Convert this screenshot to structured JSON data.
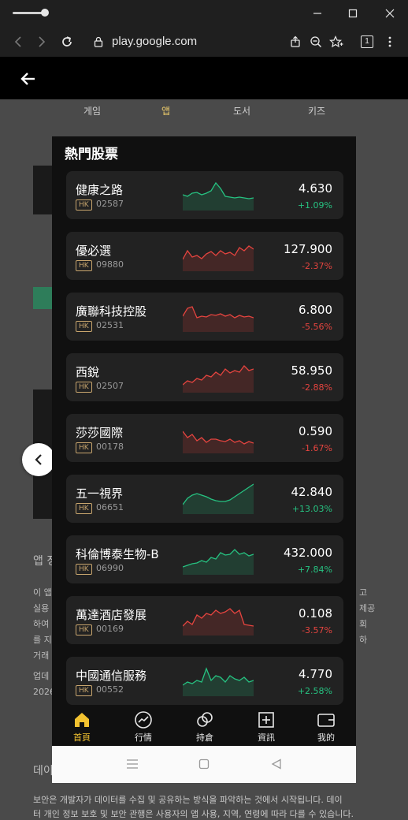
{
  "browser": {
    "url": "play.google.com",
    "tab_count": "1"
  },
  "store_tabs": [
    "게임",
    "앱",
    "도서",
    "키즈"
  ],
  "bg_snippets": {
    "l1": "이 앱",
    "l2": "실용",
    "l3": "하여",
    "l4": "를 지",
    "l5": "거래",
    "safety_title": "업데",
    "safety_year": "2026",
    "section_a": "앱 정",
    "section_b": "데이",
    "right1": "고",
    "right2": "제공",
    "right3": "회",
    "right4": "하",
    "footer1": "보안은 개발자가 데이터를 수집 및 공유하는 방식을 파악하는 것에서 시작됩니다. 데이",
    "footer2": "터 개인 정보 보호 및 보안 관행은 사용자의 앱 사용, 지역, 연령에 따라 다를 수 있습니다."
  },
  "app": {
    "title": "熱門股票",
    "stocks": [
      {
        "name": "健康之路",
        "market": "HK",
        "code": "02587",
        "price": "4.630",
        "change": "+1.09%",
        "dir": "up"
      },
      {
        "name": "優必選",
        "market": "HK",
        "code": "09880",
        "price": "127.900",
        "change": "-2.37%",
        "dir": "down"
      },
      {
        "name": "廣聯科技控股",
        "market": "HK",
        "code": "02531",
        "price": "6.800",
        "change": "-5.56%",
        "dir": "down"
      },
      {
        "name": "西銳",
        "market": "HK",
        "code": "02507",
        "price": "58.950",
        "change": "-2.88%",
        "dir": "down"
      },
      {
        "name": "莎莎國際",
        "market": "HK",
        "code": "00178",
        "price": "0.590",
        "change": "-1.67%",
        "dir": "down"
      },
      {
        "name": "五一視界",
        "market": "HK",
        "code": "06651",
        "price": "42.840",
        "change": "+13.03%",
        "dir": "up"
      },
      {
        "name": "科倫博泰生物-B",
        "market": "HK",
        "code": "06990",
        "price": "432.000",
        "change": "+7.84%",
        "dir": "up"
      },
      {
        "name": "萬達酒店發展",
        "market": "HK",
        "code": "00169",
        "price": "0.108",
        "change": "-3.57%",
        "dir": "down"
      },
      {
        "name": "中國通信服務",
        "market": "HK",
        "code": "00552",
        "price": "4.770",
        "change": "+2.58%",
        "dir": "up"
      }
    ],
    "nav": [
      {
        "label": "首頁",
        "icon": "home-icon"
      },
      {
        "label": "行情",
        "icon": "trend-icon"
      },
      {
        "label": "持倉",
        "icon": "holdings-icon"
      },
      {
        "label": "資訊",
        "icon": "news-icon"
      },
      {
        "label": "我的",
        "icon": "wallet-icon"
      }
    ]
  },
  "colors": {
    "up": "#26c281",
    "down": "#e5443f",
    "accent": "#f2c230",
    "hk_badge": "#c9a66e"
  }
}
